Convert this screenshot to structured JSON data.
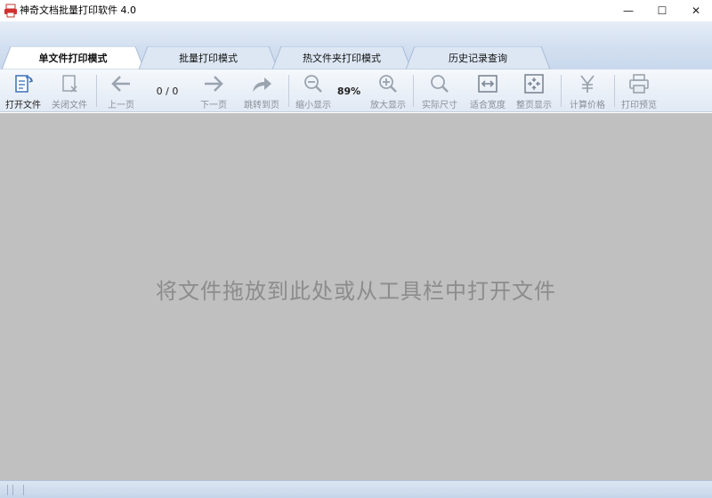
{
  "window": {
    "title": "神奇文档批量打印软件 4.0",
    "minimize": "—",
    "maximize": "☐",
    "close": "✕"
  },
  "tabs": [
    {
      "label": "单文件打印模式",
      "active": true
    },
    {
      "label": "批量打印模式",
      "active": false
    },
    {
      "label": "热文件夹打印模式",
      "active": false
    },
    {
      "label": "历史记录查询",
      "active": false
    }
  ],
  "toolbar": {
    "open_file": "打开文件",
    "close_file": "关闭文件",
    "prev_page": "上一页",
    "page_indicator": "0 / 0",
    "next_page": "下一页",
    "goto_page": "跳转到页",
    "zoom_out": "缩小显示",
    "zoom_level": "89%",
    "zoom_in": "放大显示",
    "actual_size": "实际尺寸",
    "fit_width": "适合宽度",
    "fit_page": "整页显示",
    "calc_price": "计算价格",
    "print_preview": "打印预览"
  },
  "main": {
    "drop_hint": "将文件拖放到此处或从工具栏中打开文件"
  },
  "colors": {
    "canvas": "#c0c0c0",
    "hint_text": "#8c8c8c",
    "icon_enabled": "#3a70b8",
    "icon_disabled": "#9aa3ae"
  }
}
